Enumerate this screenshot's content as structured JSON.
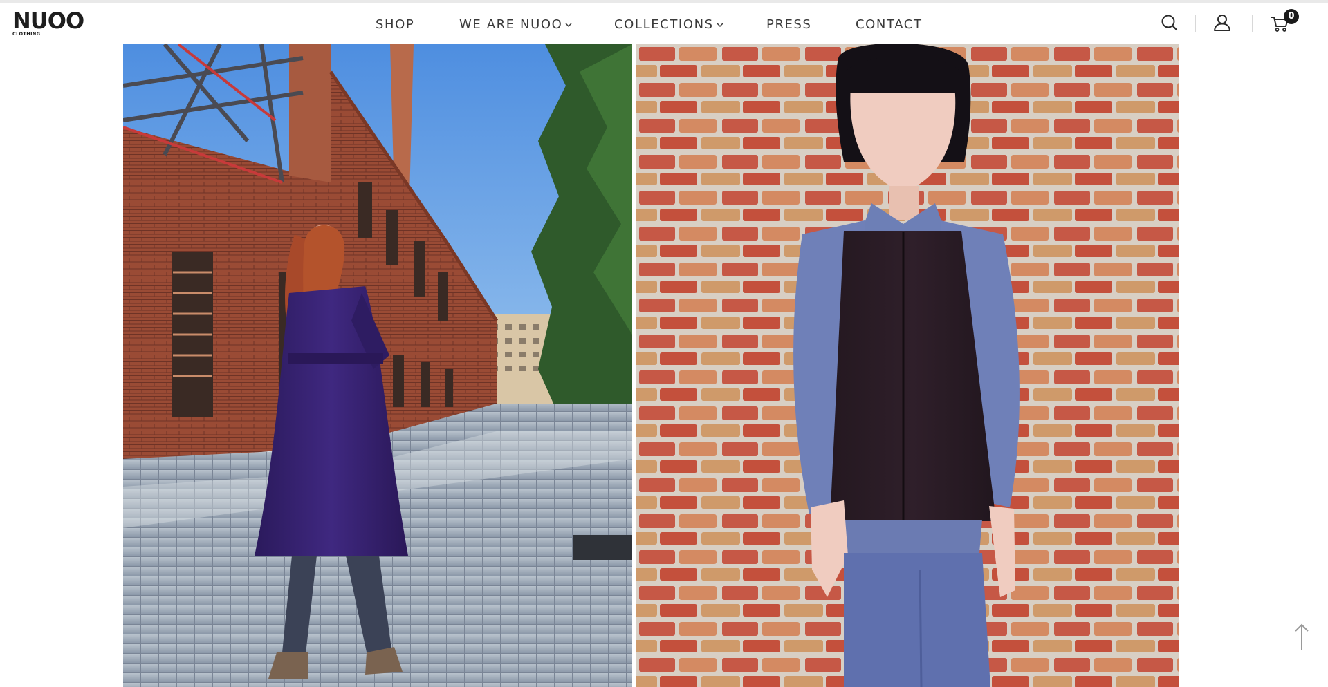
{
  "brand": {
    "name": "NUOO",
    "tagline": "CLOTHING"
  },
  "nav": {
    "items": [
      {
        "label": "SHOP",
        "has_dropdown": false
      },
      {
        "label": "WE ARE NUOO",
        "has_dropdown": true
      },
      {
        "label": "COLLECTIONS",
        "has_dropdown": true
      },
      {
        "label": "PRESS",
        "has_dropdown": false
      },
      {
        "label": "CONTACT",
        "has_dropdown": false
      }
    ]
  },
  "header_actions": {
    "search_icon": "search-icon",
    "account_icon": "user-icon",
    "cart_icon": "cart-icon",
    "cart_count": "0"
  },
  "gallery": {
    "photos": [
      {
        "subject": "model in purple belted coat on brick industrial street"
      },
      {
        "subject": "model in blue and black shirt against brick wall"
      }
    ]
  },
  "colors": {
    "text": "#3a3a3a",
    "badge": "#1a1a1a",
    "coat_purple": "#3a2470",
    "shirt_blue": "#6f7fb4"
  }
}
